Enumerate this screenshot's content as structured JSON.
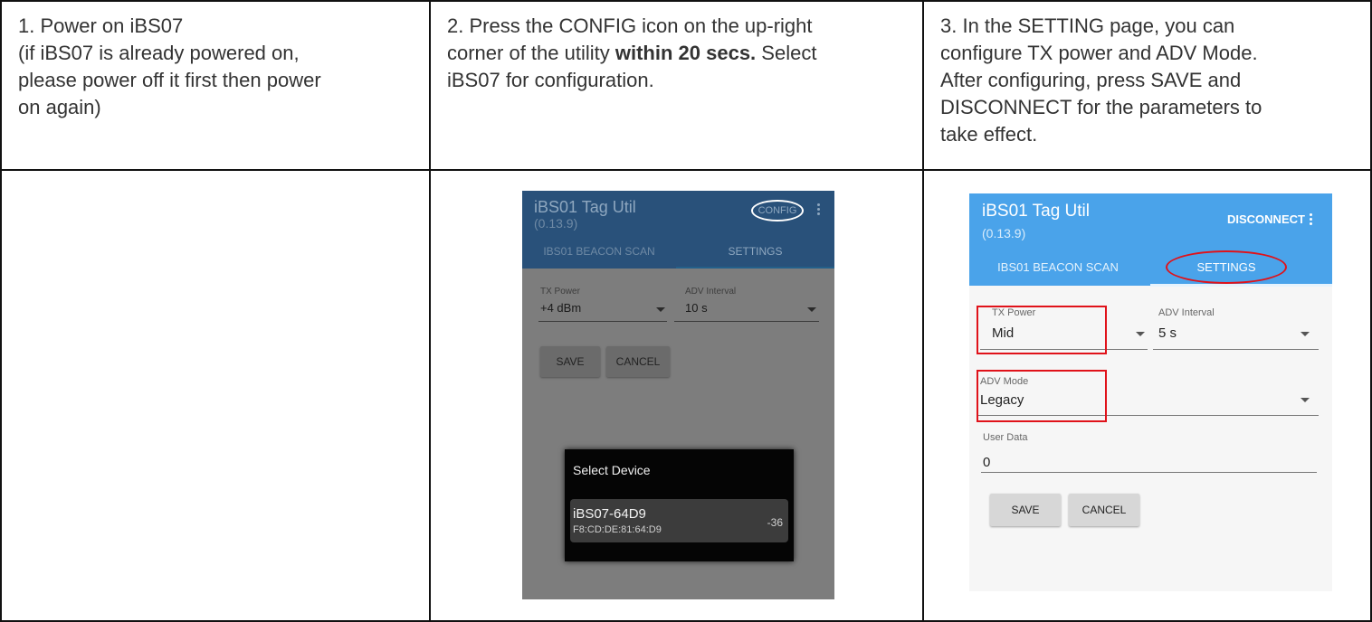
{
  "steps": [
    {
      "line1": "1. Power on iBS07",
      "line2": "(if iBS07 is already powered on,",
      "line3": "please power off it first then power",
      "line4": "on again)"
    },
    {
      "line1": "2. Press the CONFIG icon on the up-right",
      "line2_pre": "corner of the utility ",
      "line2_bold": "within 20 secs.",
      "line2_post": " Select",
      "line3": "iBS07 for configuration."
    },
    {
      "line1": "3. In the SETTING page, you can",
      "line2": "configure TX power and ADV Mode.",
      "line3": "After configuring, press SAVE and",
      "line4": "DISCONNECT for the parameters to",
      "line5": "take effect."
    }
  ],
  "screen_config": {
    "app_title": "iBS01 Tag Util",
    "app_version": "(0.13.9)",
    "config_label": "CONFIG",
    "tab_scan": "IBS01 BEACON SCAN",
    "tab_settings": "SETTINGS",
    "tx_label": "TX Power",
    "tx_value": "+4 dBm",
    "adv_label": "ADV Interval",
    "adv_value": "10 s",
    "save_label": "SAVE",
    "cancel_label": "CANCEL",
    "dialog_title": "Select Device",
    "device_name": "iBS07-64D9",
    "device_mac": "F8:CD:DE:81:64:D9",
    "device_rssi": "-36"
  },
  "screen_settings": {
    "app_title": "iBS01 Tag Util",
    "app_version": "(0.13.9)",
    "disconnect_label": "DISCONNECT",
    "tab_scan": "IBS01 BEACON SCAN",
    "tab_settings": "SETTINGS",
    "tx_label": "TX Power",
    "tx_value": "Mid",
    "adv_label": "ADV Interval",
    "adv_value": "5 s",
    "mode_label": "ADV Mode",
    "mode_value": "Legacy",
    "user_label": "User Data",
    "user_value": "0",
    "save_label": "SAVE",
    "cancel_label": "CANCEL"
  },
  "colors": {
    "border": "#111111",
    "appbar_blue": "#4aa3ea",
    "appbar_dim": "#29517a",
    "highlight_red": "#e0121a",
    "dialog_bg": "#050505"
  }
}
